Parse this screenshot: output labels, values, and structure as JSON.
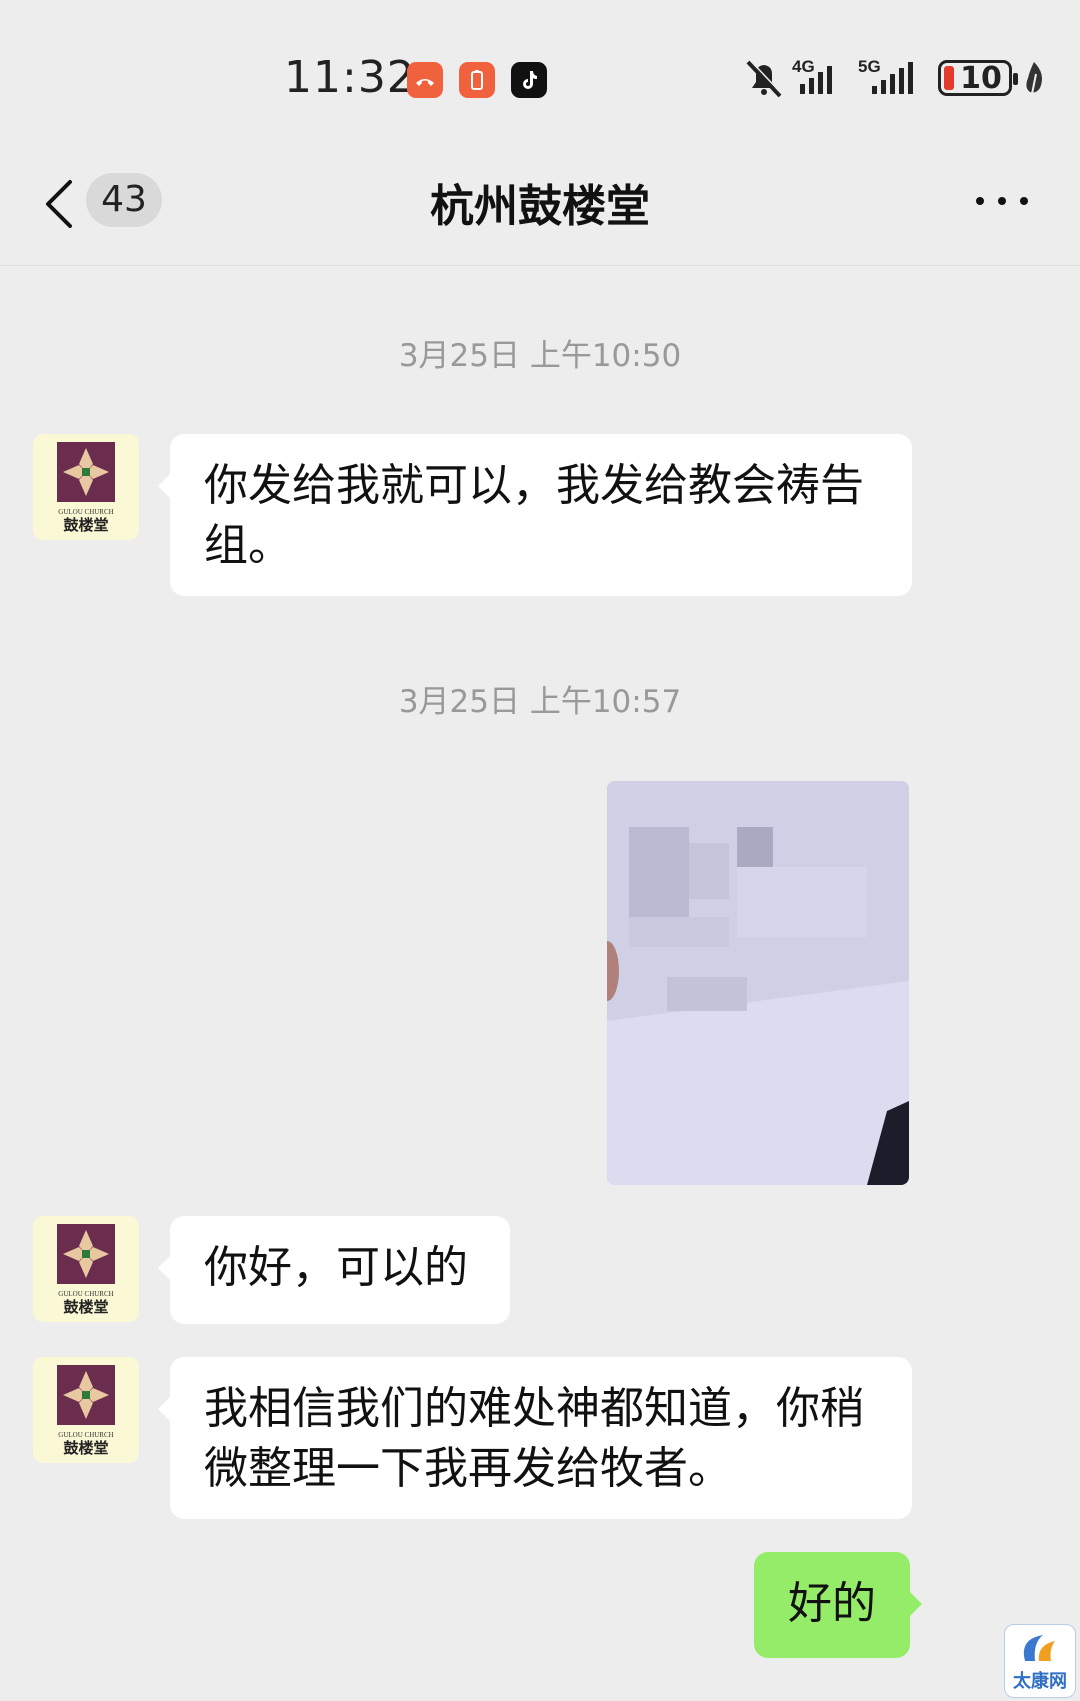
{
  "status_bar": {
    "time": "11:32",
    "app_icons": [
      "missed-call-icon",
      "battery-alert-icon",
      "tiktok-icon"
    ],
    "silent_icon": "bell-off-icon",
    "network_1": "4G",
    "network_2": "5G",
    "battery_level": "10"
  },
  "header": {
    "unread_count": "43",
    "title": "杭州鼓楼堂"
  },
  "messages": [
    {
      "type": "timestamp",
      "text": "3月25日 上午10:50"
    },
    {
      "type": "text",
      "from": "other",
      "text": "你发给我就可以，我发给教会祷告组。"
    },
    {
      "type": "timestamp",
      "text": "3月25日 上午10:57"
    },
    {
      "type": "image",
      "from": "me"
    },
    {
      "type": "text",
      "from": "other",
      "text": "你好，可以的"
    },
    {
      "type": "text",
      "from": "other",
      "text": "我相信我们的难处神都知道，你稍微整理一下我再发给牧者。"
    },
    {
      "type": "text",
      "from": "me",
      "text": "好的"
    }
  ],
  "avatar": {
    "name_en": "GULOU CHURCH",
    "name_zh": "鼓楼堂"
  },
  "watermark": {
    "text": "太康网"
  },
  "colors": {
    "background": "#ededed",
    "bubble_other": "#ffffff",
    "bubble_me": "#95ec69",
    "avatar_bg": "#fbf8d6",
    "avatar_purple": "#6b2d4e"
  }
}
